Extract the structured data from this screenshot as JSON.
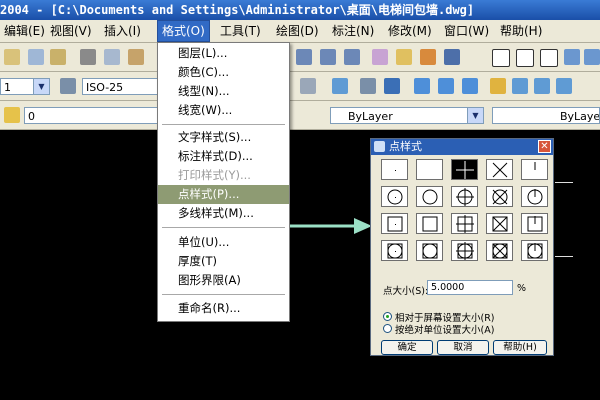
{
  "window": {
    "title": "2004 - [C:\\Documents and Settings\\Administrator\\桌面\\电梯间包墙.dwg]"
  },
  "menubar": {
    "items": [
      {
        "label": "编辑(E)"
      },
      {
        "label": "视图(V)"
      },
      {
        "label": "插入(I)"
      },
      {
        "label": "格式(O)"
      },
      {
        "label": "工具(T)"
      },
      {
        "label": "绘图(D)"
      },
      {
        "label": "标注(N)"
      },
      {
        "label": "修改(M)"
      },
      {
        "label": "窗口(W)"
      },
      {
        "label": "帮助(H)"
      }
    ],
    "active_index": 3
  },
  "toolbar2": {
    "dimstyle": "ISO-25"
  },
  "toolbar3": {
    "layer": "0",
    "color": "ByLayer",
    "linetype": "ByLayer"
  },
  "format_menu": {
    "items": [
      {
        "label": "图层(L)...",
        "state": "normal"
      },
      {
        "label": "颜色(C)...",
        "state": "normal"
      },
      {
        "label": "线型(N)...",
        "state": "normal"
      },
      {
        "label": "线宽(W)...",
        "state": "normal"
      },
      {
        "label": "文字样式(S)...",
        "state": "normal"
      },
      {
        "label": "标注样式(D)...",
        "state": "normal"
      },
      {
        "label": "打印样式(Y)...",
        "state": "disabled"
      },
      {
        "label": "点样式(P)...",
        "state": "highlight"
      },
      {
        "label": "多线样式(M)...",
        "state": "normal"
      },
      {
        "label": "单位(U)...",
        "state": "normal"
      },
      {
        "label": "厚度(T)",
        "state": "normal"
      },
      {
        "label": "图形界限(A)",
        "state": "normal"
      },
      {
        "label": "重命名(R)...",
        "state": "normal"
      }
    ]
  },
  "point_style_dialog": {
    "title": "点样式",
    "close_glyph": "✕",
    "size_label": "点大小(S):",
    "size_value": "5.0000",
    "size_unit": "%",
    "radio_relative": "相对于屏幕设置大小(R)",
    "radio_absolute": "按绝对单位设置大小(A)",
    "selected_radio": "relative",
    "selected_style_index": 2,
    "ok_label": "确定",
    "cancel_label": "取消",
    "help_label": "帮助(H)"
  },
  "colors": {
    "titlebar": "#1a4fa8",
    "highlight": "#8e9b73",
    "arrow": "#9be0c6",
    "canvas": "#000000"
  }
}
